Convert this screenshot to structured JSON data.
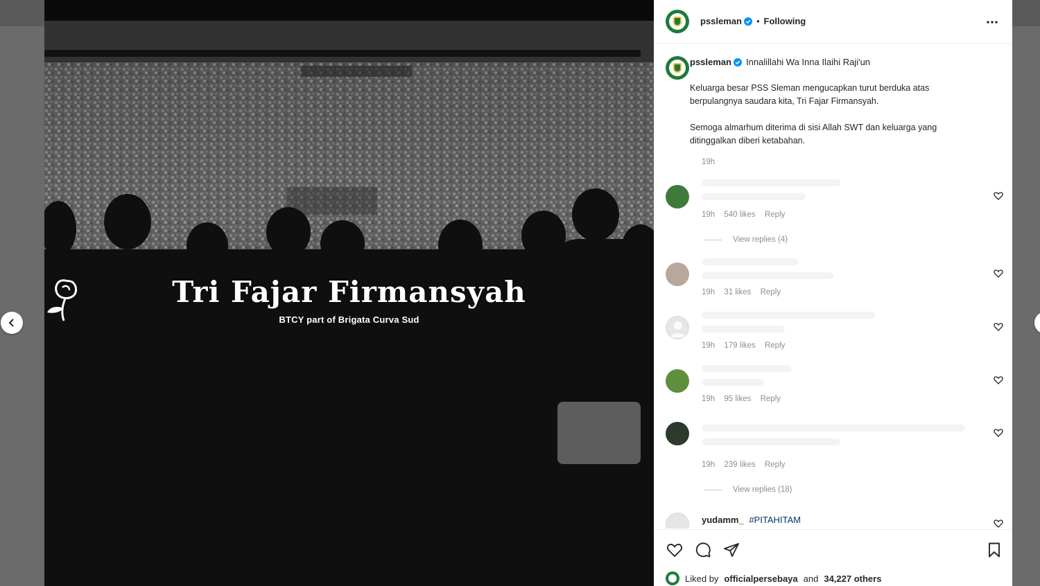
{
  "post": {
    "memorial_name": "Tri Fajar Firmansyah",
    "memorial_subtitle": "BTCY part of Brigata Curva Sud"
  },
  "header": {
    "username": "pssleman",
    "separator": "•",
    "follow_status": "Following"
  },
  "caption": {
    "username": "pssleman",
    "first_line": "Innalillahi Wa Inna Ilaihi Raji'un",
    "paragraph1": "Keluarga besar PSS Sleman mengucapkan turut berduka atas berpulangnya saudara kita, Tri Fajar Firmansyah.",
    "paragraph2": "Semoga almarhum diterima di sisi Allah SWT dan keluarga yang ditinggalkan diberi ketabahan.",
    "time": "19h"
  },
  "comments": [
    {
      "time": "19h",
      "likes": "540 likes",
      "reply": "Reply",
      "view_replies": "View replies (4)",
      "avatar_color": "#3f7a3a"
    },
    {
      "time": "19h",
      "likes": "31 likes",
      "reply": "Reply",
      "avatar_color": "#b8a79a"
    },
    {
      "time": "19h",
      "likes": "179 likes",
      "reply": "Reply",
      "avatar_color": "#dbdbdb"
    },
    {
      "time": "19h",
      "likes": "95 likes",
      "reply": "Reply",
      "avatar_color": "#5d8f3c"
    },
    {
      "time": "19h",
      "likes": "239 likes",
      "reply": "Reply",
      "view_replies": "View replies (18)",
      "avatar_color": "#2b3a2a"
    }
  ],
  "last_comment": {
    "username": "yudamm_",
    "text": "#PITAHITAM"
  },
  "likes": {
    "prefix": "Liked by",
    "user": "officialpersebaya",
    "middle": "and",
    "count": "34,227 others"
  },
  "colors": {
    "brand_green": "#1f7a3a",
    "verified_blue": "#0095f6",
    "link_blue": "#00376b"
  }
}
